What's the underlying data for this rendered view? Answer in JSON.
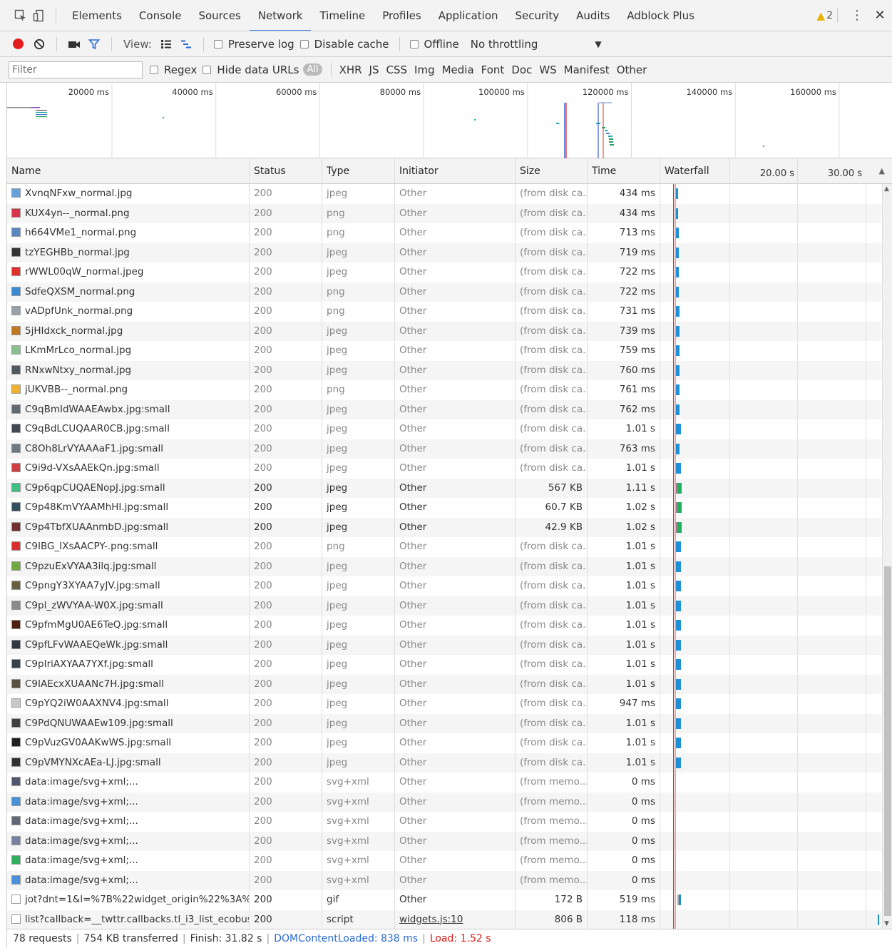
{
  "tabs": [
    "Elements",
    "Console",
    "Sources",
    "Network",
    "Timeline",
    "Profiles",
    "Application",
    "Security",
    "Audits",
    "Adblock Plus"
  ],
  "active_tab": "Network",
  "warning_count": "2",
  "controls": {
    "view_label": "View:",
    "preserve_log": "Preserve log",
    "disable_cache": "Disable cache",
    "offline": "Offline",
    "throttling": "No throttling"
  },
  "filter": {
    "placeholder": "Filter",
    "regex": "Regex",
    "hide_data_urls": "Hide data URLs",
    "all": "All",
    "types": [
      "XHR",
      "JS",
      "CSS",
      "Img",
      "Media",
      "Font",
      "Doc",
      "WS",
      "Manifest",
      "Other"
    ]
  },
  "overview": {
    "ticks": [
      "20000 ms",
      "40000 ms",
      "60000 ms",
      "80000 ms",
      "100000 ms",
      "120000 ms",
      "140000 ms",
      "160000 ms"
    ]
  },
  "columns": {
    "name": "Name",
    "status": "Status",
    "type": "Type",
    "initiator": "Initiator",
    "size": "Size",
    "time": "Time",
    "waterfall": "Waterfall",
    "tick1": "20.00 s",
    "tick2": "30.00 s"
  },
  "requests": [
    {
      "name": "XvnqNFxw_normal.jpg",
      "status": "200",
      "type": "jpeg",
      "initiator": "Other",
      "size": "(from disk ca...",
      "time": "434 ms",
      "icon": "#6aa0d8"
    },
    {
      "name": "KUX4yn--_normal.png",
      "status": "200",
      "type": "png",
      "initiator": "Other",
      "size": "(from disk ca...",
      "time": "434 ms",
      "icon": "#d8344a"
    },
    {
      "name": "h664VMe1_normal.png",
      "status": "200",
      "type": "png",
      "initiator": "Other",
      "size": "(from disk ca...",
      "time": "713 ms",
      "icon": "#5a88c0"
    },
    {
      "name": "tzYEGHBb_normal.jpg",
      "status": "200",
      "type": "jpeg",
      "initiator": "Other",
      "size": "(from disk ca...",
      "time": "719 ms",
      "icon": "#333333"
    },
    {
      "name": "rWWL00qW_normal.jpeg",
      "status": "200",
      "type": "jpeg",
      "initiator": "Other",
      "size": "(from disk ca...",
      "time": "722 ms",
      "icon": "#e03030"
    },
    {
      "name": "SdfeQXSM_normal.png",
      "status": "200",
      "type": "png",
      "initiator": "Other",
      "size": "(from disk ca...",
      "time": "722 ms",
      "icon": "#3a8ad0"
    },
    {
      "name": "vADpfUnk_normal.png",
      "status": "200",
      "type": "png",
      "initiator": "Other",
      "size": "(from disk ca...",
      "time": "731 ms",
      "icon": "#9aa0a8"
    },
    {
      "name": "5jHIdxck_normal.jpg",
      "status": "200",
      "type": "jpeg",
      "initiator": "Other",
      "size": "(from disk ca...",
      "time": "739 ms",
      "icon": "#c07820"
    },
    {
      "name": "LKmMrLco_normal.jpg",
      "status": "200",
      "type": "jpeg",
      "initiator": "Other",
      "size": "(from disk ca...",
      "time": "759 ms",
      "icon": "#8ac090"
    },
    {
      "name": "RNxwNtxy_normal.jpg",
      "status": "200",
      "type": "jpeg",
      "initiator": "Other",
      "size": "(from disk ca...",
      "time": "760 ms",
      "icon": "#505860"
    },
    {
      "name": "jUKVBB--_normal.png",
      "status": "200",
      "type": "png",
      "initiator": "Other",
      "size": "(from disk ca...",
      "time": "761 ms",
      "icon": "#f0b030"
    },
    {
      "name": "C9qBmIdWAAEAwbx.jpg:small",
      "status": "200",
      "type": "jpeg",
      "initiator": "Other",
      "size": "(from disk ca...",
      "time": "762 ms",
      "icon": "#606870"
    },
    {
      "name": "C9qBdLCUQAAR0CB.jpg:small",
      "status": "200",
      "type": "jpeg",
      "initiator": "Other",
      "size": "(from disk ca...",
      "time": "1.01 s",
      "icon": "#404850"
    },
    {
      "name": "C8Oh8LrVYAAAaF1.jpg:small",
      "status": "200",
      "type": "jpeg",
      "initiator": "Other",
      "size": "(from disk ca...",
      "time": "763 ms",
      "icon": "#707880"
    },
    {
      "name": "C9i9d-VXsAAEkQn.jpg:small",
      "status": "200",
      "type": "jpeg",
      "initiator": "Other",
      "size": "(from disk ca...",
      "time": "1.01 s",
      "icon": "#d04040"
    },
    {
      "name": "C9p6qpCUQAENopJ.jpg:small",
      "status": "200",
      "type": "jpeg",
      "initiator": "Other",
      "size": "567 KB",
      "time": "1.11 s",
      "icon": "#40c080"
    },
    {
      "name": "C9p48KmVYAAMhHI.jpg:small",
      "status": "200",
      "type": "jpeg",
      "initiator": "Other",
      "size": "60.7 KB",
      "time": "1.02 s",
      "icon": "#305060"
    },
    {
      "name": "C9p4TbfXUAAnmbD.jpg:small",
      "status": "200",
      "type": "jpeg",
      "initiator": "Other",
      "size": "42.9 KB",
      "time": "1.02 s",
      "icon": "#703030"
    },
    {
      "name": "C9IBG_IXsAACPY-.png:small",
      "status": "200",
      "type": "png",
      "initiator": "Other",
      "size": "(from disk ca...",
      "time": "1.01 s",
      "icon": "#d83030"
    },
    {
      "name": "C9pzuExVYAA3ilq.jpg:small",
      "status": "200",
      "type": "jpeg",
      "initiator": "Other",
      "size": "(from disk ca...",
      "time": "1.01 s",
      "icon": "#70a840"
    },
    {
      "name": "C9pngY3XYAA7yJV.jpg:small",
      "status": "200",
      "type": "jpeg",
      "initiator": "Other",
      "size": "(from disk ca...",
      "time": "1.01 s",
      "icon": "#686040"
    },
    {
      "name": "C9pl_zWVYAA-W0X.jpg:small",
      "status": "200",
      "type": "jpeg",
      "initiator": "Other",
      "size": "(from disk ca...",
      "time": "1.01 s",
      "icon": "#8a8a8a"
    },
    {
      "name": "C9pfmMgU0AE6TeQ.jpg:small",
      "status": "200",
      "type": "jpeg",
      "initiator": "Other",
      "size": "(from disk ca...",
      "time": "1.01 s",
      "icon": "#502010"
    },
    {
      "name": "C9pfLFvWAAEQeWk.jpg:small",
      "status": "200",
      "type": "jpeg",
      "initiator": "Other",
      "size": "(from disk ca...",
      "time": "1.01 s",
      "icon": "#303840"
    },
    {
      "name": "C9pIriAXYAA7YXf.jpg:small",
      "status": "200",
      "type": "jpeg",
      "initiator": "Other",
      "size": "(from disk ca...",
      "time": "1.01 s",
      "icon": "#384048"
    },
    {
      "name": "C9IAEcxXUAANc7H.jpg:small",
      "status": "200",
      "type": "jpeg",
      "initiator": "Other",
      "size": "(from disk ca...",
      "time": "1.01 s",
      "icon": "#585040"
    },
    {
      "name": "C9pYQ2iW0AAXNV4.jpg:small",
      "status": "200",
      "type": "jpeg",
      "initiator": "Other",
      "size": "(from disk ca...",
      "time": "947 ms",
      "icon": "#c8c8c8"
    },
    {
      "name": "C9PdQNUWAAEw109.jpg:small",
      "status": "200",
      "type": "jpeg",
      "initiator": "Other",
      "size": "(from disk ca...",
      "time": "1.01 s",
      "icon": "#404040"
    },
    {
      "name": "C9pVuzGV0AAKwWS.jpg:small",
      "status": "200",
      "type": "jpeg",
      "initiator": "Other",
      "size": "(from disk ca...",
      "time": "1.01 s",
      "icon": "#202020"
    },
    {
      "name": "C9pVMYNXcAEa-LJ.jpg:small",
      "status": "200",
      "type": "jpeg",
      "initiator": "Other",
      "size": "(from disk ca...",
      "time": "1.01 s",
      "icon": "#303030"
    },
    {
      "name": "data:image/svg+xml;...",
      "status": "200",
      "type": "svg+xml",
      "initiator": "Other",
      "size": "(from memo...",
      "time": "0 ms",
      "icon": "#505870"
    },
    {
      "name": "data:image/svg+xml;...",
      "status": "200",
      "type": "svg+xml",
      "initiator": "Other",
      "size": "(from memo...",
      "time": "0 ms",
      "icon": "#4a90d8"
    },
    {
      "name": "data:image/svg+xml;...",
      "status": "200",
      "type": "svg+xml",
      "initiator": "Other",
      "size": "(from memo...",
      "time": "0 ms",
      "icon": "#606878"
    },
    {
      "name": "data:image/svg+xml;...",
      "status": "200",
      "type": "svg+xml",
      "initiator": "Other",
      "size": "(from memo...",
      "time": "0 ms",
      "icon": "#7880a0"
    },
    {
      "name": "data:image/svg+xml;...",
      "status": "200",
      "type": "svg+xml",
      "initiator": "Other",
      "size": "(from memo...",
      "time": "0 ms",
      "icon": "#30b060"
    },
    {
      "name": "data:image/svg+xml;...",
      "status": "200",
      "type": "svg+xml",
      "initiator": "Other",
      "size": "(from memo...",
      "time": "0 ms",
      "icon": "#4a90d8"
    },
    {
      "name": "jot?dnt=1&l=%7B%22widget_origin%22%3A%...",
      "status": "200",
      "type": "gif",
      "initiator": "Other",
      "size": "172 B",
      "time": "519 ms",
      "icon": "#ffffff"
    },
    {
      "name": "list?callback=__twttr.callbacks.tl_i3_list_ecobus...",
      "status": "200",
      "type": "script",
      "initiator": "widgets.js:10",
      "size": "806 B",
      "time": "118 ms",
      "icon": "#ffffff"
    }
  ],
  "status": {
    "requests": "78 requests",
    "transferred": "754 KB transferred",
    "finish": "Finish: 31.82 s",
    "dom": "DOMContentLoaded: 838 ms",
    "load": "Load: 1.52 s"
  }
}
